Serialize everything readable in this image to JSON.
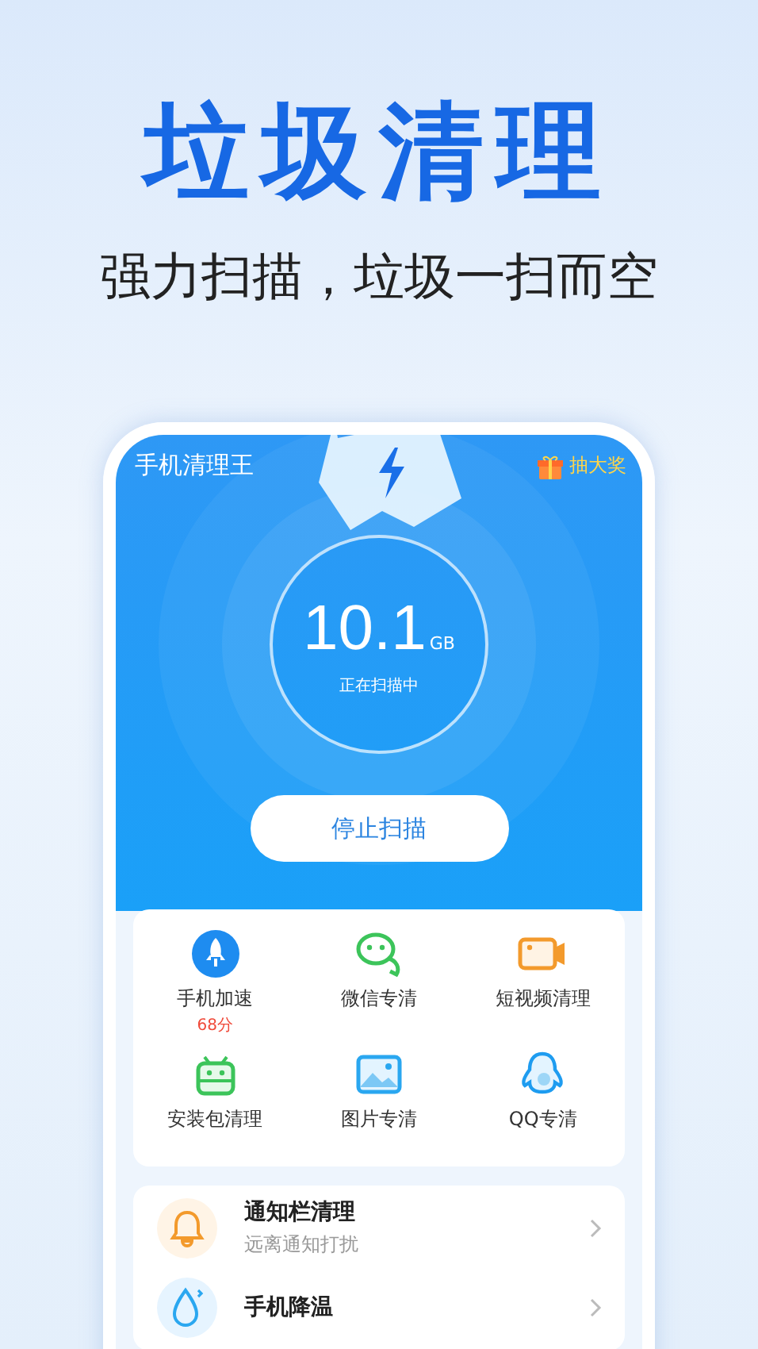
{
  "headline": "垃圾清理",
  "subtitle": "强力扫描，垃圾一扫而空",
  "app": {
    "title": "手机清理王",
    "prize": "抽大奖"
  },
  "scan": {
    "value": "10.1",
    "unit": "GB",
    "status": "正在扫描中",
    "button": "停止扫描"
  },
  "features": [
    {
      "kind": "rocket",
      "label": "手机加速",
      "score": "68分"
    },
    {
      "kind": "chat",
      "label": "微信专清"
    },
    {
      "kind": "video",
      "label": "短视频清理"
    },
    {
      "kind": "android",
      "label": "安装包清理"
    },
    {
      "kind": "image",
      "label": "图片专清"
    },
    {
      "kind": "penguin",
      "label": "QQ专清"
    }
  ],
  "tools": [
    {
      "kind": "bell",
      "title": "通知栏清理",
      "subtitle": "远离通知打扰"
    },
    {
      "kind": "drop",
      "title": "手机降温"
    }
  ]
}
